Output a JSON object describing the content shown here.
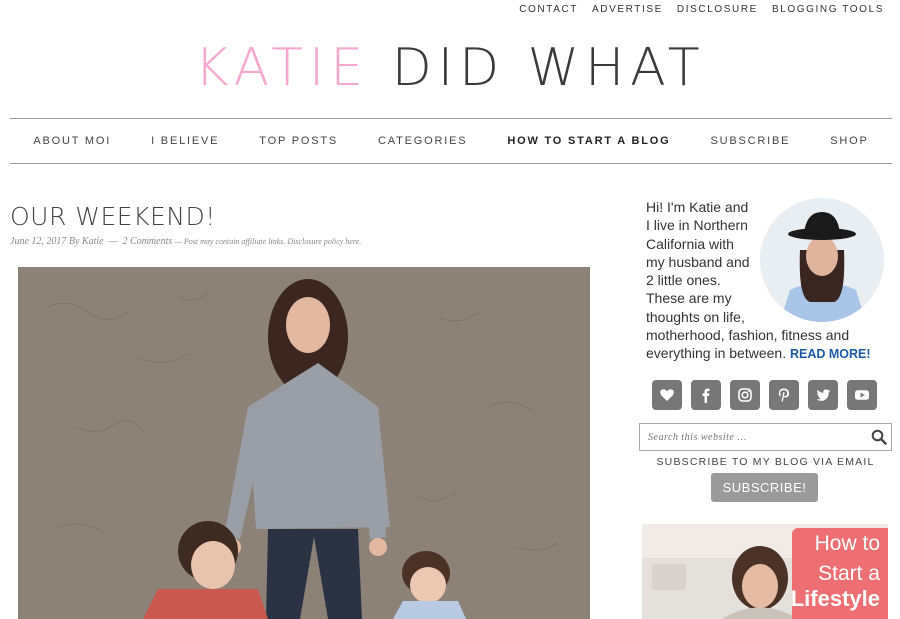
{
  "top_links": [
    "CONTACT",
    "ADVERTISE",
    "DISCLOSURE",
    "BLOGGING TOOLS"
  ],
  "logo": {
    "part1": "KATIE",
    "part2": "DID WHAT"
  },
  "nav": [
    "ABOUT MOI",
    "I BELIEVE",
    "TOP POSTS",
    "CATEGORIES",
    "HOW TO START A BLOG",
    "SUBSCRIBE",
    "SHOP"
  ],
  "post": {
    "title": "OUR WEEKEND!",
    "date": "June 12, 2017",
    "by": "By",
    "author": "Katie",
    "comments": "2 Comments",
    "disclosure": "Post may contain affiliate links. Disclosure policy here."
  },
  "sidebar": {
    "bio_lines": [
      "Hi! I'm Katie and",
      "I live in Northern",
      "California with",
      "my husband and",
      "2 little ones.",
      "These are my",
      "thoughts on life,",
      "motherhood, fashion, fitness and",
      "everything in between."
    ],
    "read_more": "READ MORE!",
    "social_icons": [
      "heart-icon",
      "facebook-icon",
      "instagram-icon",
      "pinterest-icon",
      "twitter-icon",
      "youtube-icon"
    ],
    "search_placeholder": "Search this website …",
    "subscribe_label": "SUBSCRIBE TO MY BLOG VIA EMAIL",
    "subscribe_button": "SUBSCRIBE!",
    "promo": {
      "line1": "How to",
      "line2": "Start a",
      "line3": "Lifestyle"
    }
  },
  "colors": {
    "logo_pink": "#f5a9cf",
    "link_blue": "#1e5aa8",
    "button_gray": "#9a9a9a",
    "promo_coral": "#ee6f73"
  }
}
